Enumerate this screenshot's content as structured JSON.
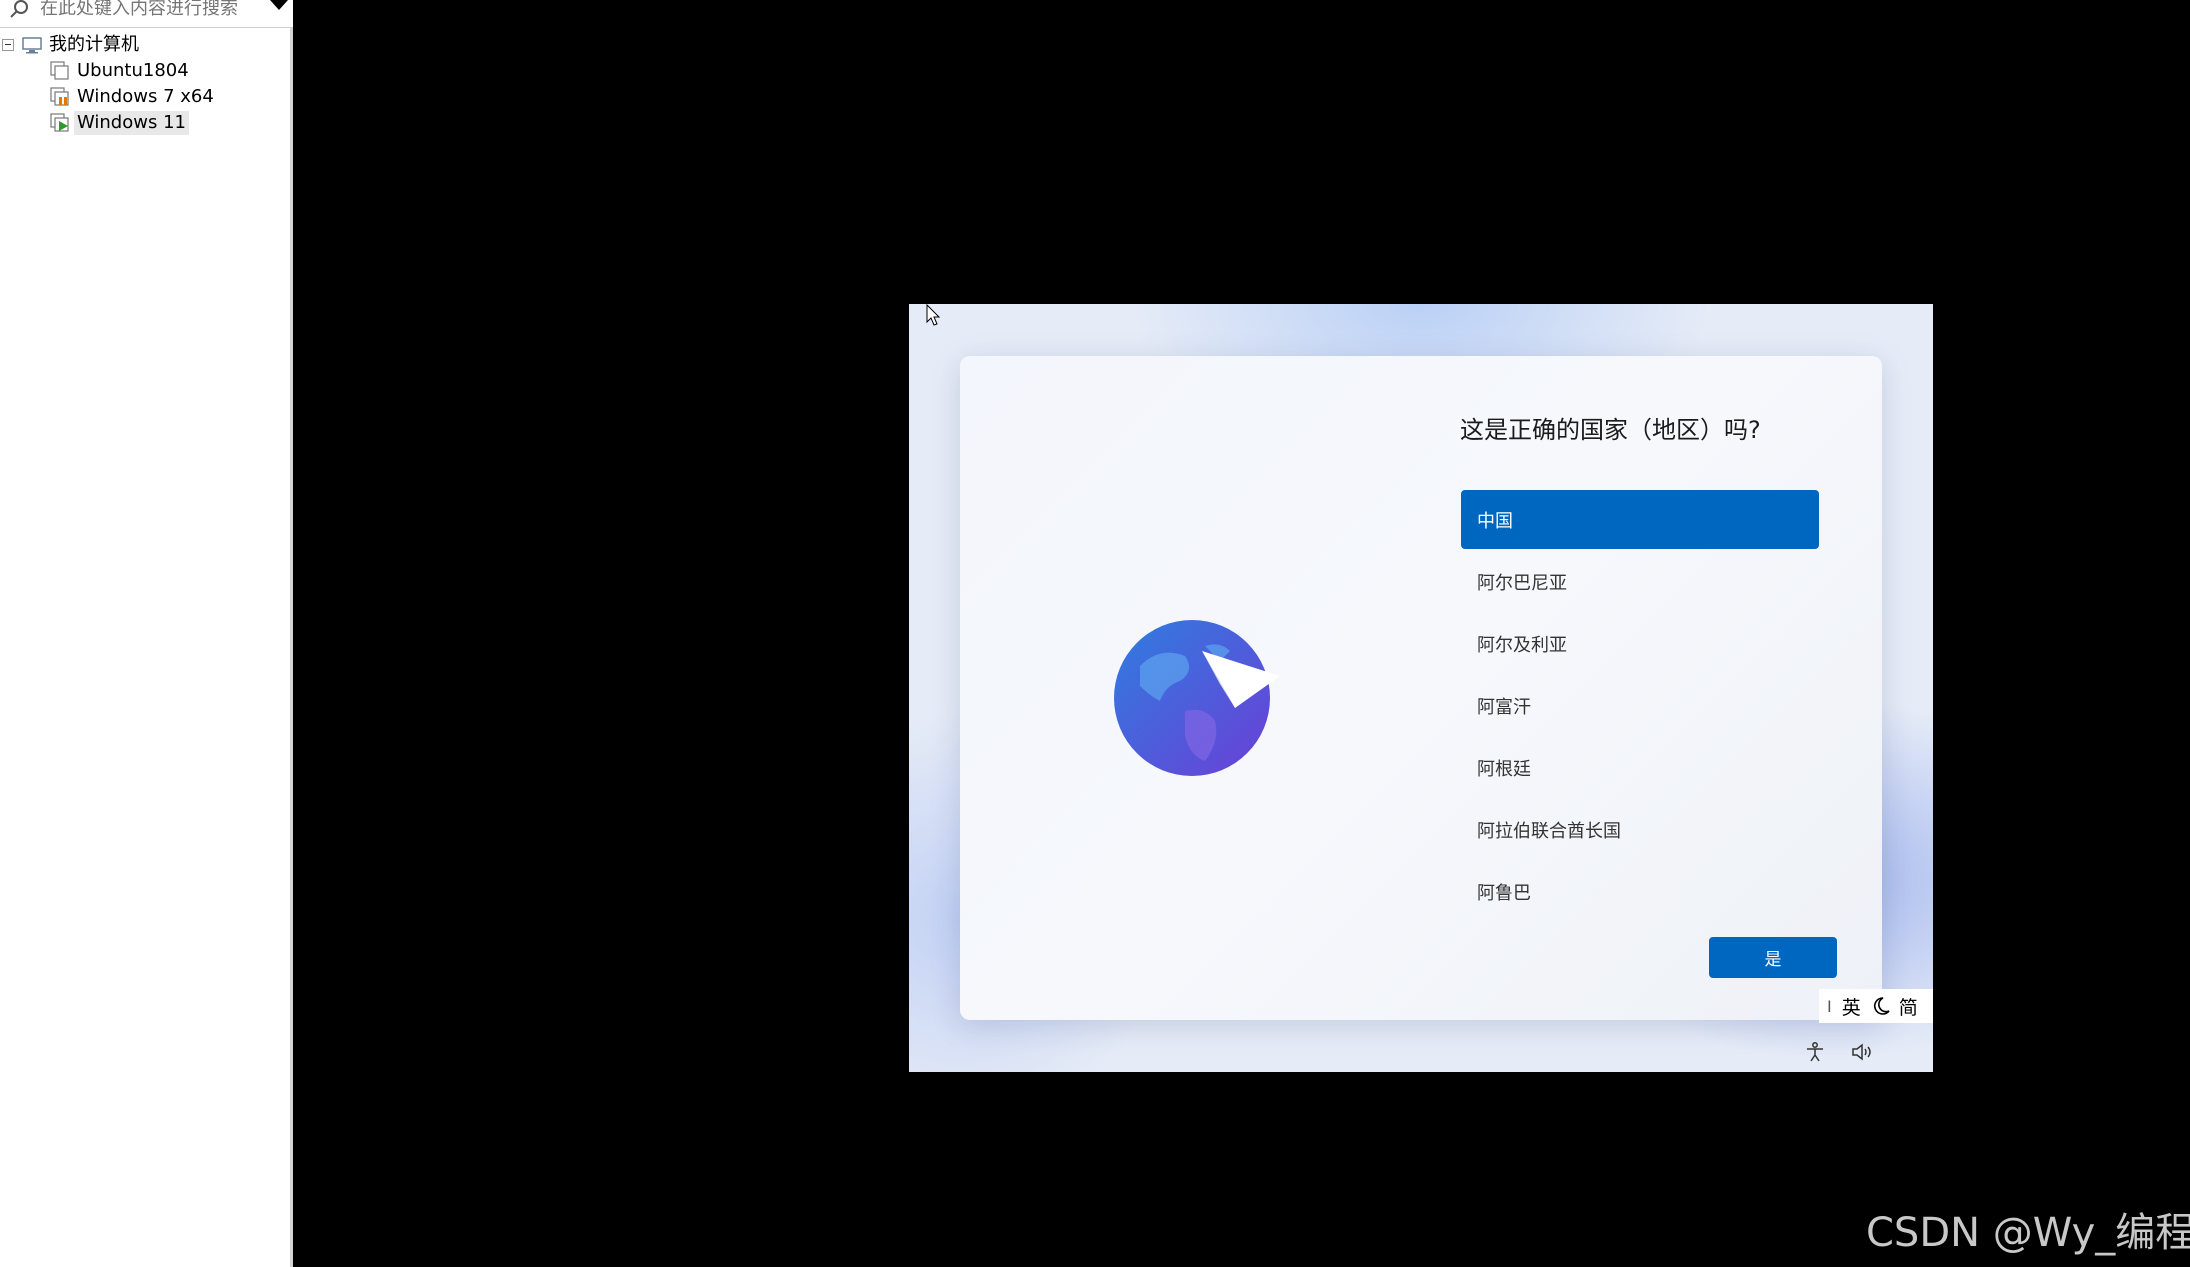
{
  "sidebar": {
    "search": {
      "placeholder": "在此处键入内容进行搜索"
    },
    "tree": {
      "root_label": "我的计算机",
      "items": [
        {
          "label": "Ubuntu1804",
          "state": "off"
        },
        {
          "label": "Windows 7 x64",
          "state": "suspended"
        },
        {
          "label": "Windows 11",
          "state": "running"
        }
      ]
    }
  },
  "vm": {
    "oobe": {
      "title": "这是正确的国家（地区）吗?",
      "countries": [
        "中国",
        "阿尔巴尼亚",
        "阿尔及利亚",
        "阿富汗",
        "阿根廷",
        "阿拉伯联合酋长国",
        "阿鲁巴"
      ],
      "selected_index": 0,
      "yes_label": "是"
    },
    "ime": {
      "separator": "I",
      "mode": "英",
      "width": "简"
    },
    "icons": [
      "accessibility-icon",
      "volume-icon",
      "mouse-cursor-icon",
      "globe-paper-plane-icon"
    ]
  },
  "watermark": "CSDN @Wy_编程",
  "colors": {
    "accent": "#0067c0",
    "background": "#000000"
  }
}
